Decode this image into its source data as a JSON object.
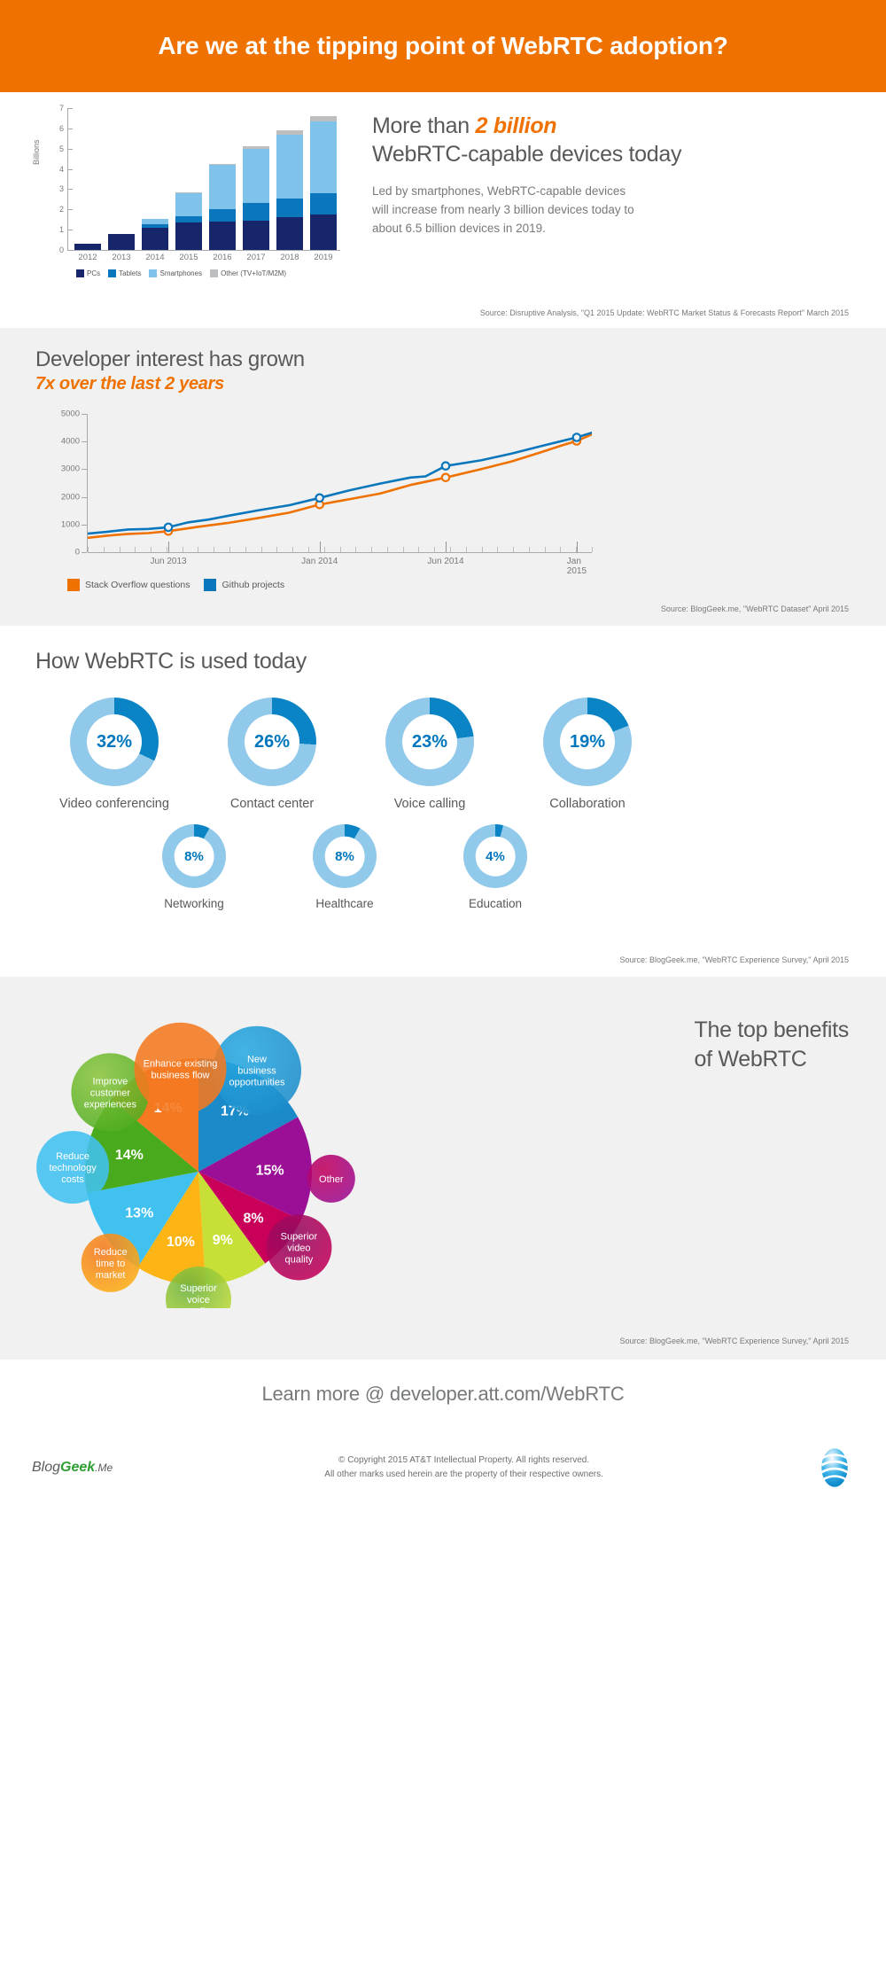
{
  "header": {
    "title": "Are we at the tipping point of WebRTC adoption?"
  },
  "section_devices": {
    "headline_pre": "More than ",
    "headline_hi": "2 billion",
    "headline_rest": "WebRTC-capable devices today",
    "body": "Led by smartphones, WebRTC-capable devices will increase from nearly 3 billion devices today to about 6.5 billion devices in 2019.",
    "source": "Source: Disruptive Analysis, \"Q1 2015 Update: WebRTC Market Status & Forecasts Report\" March 2015"
  },
  "section_developer": {
    "headline": "Developer interest has grown",
    "subhead": "7x over the last 2 years",
    "source": "Source: BlogGeek.me, \"WebRTC Dataset\" April 2015"
  },
  "section_usage": {
    "headline": "How WebRTC is used today",
    "source": "Source: BlogGeek.me, \"WebRTC Experience Survey,\" April 2015"
  },
  "section_benefits": {
    "headline_l1": "The top benefits",
    "headline_l2": "of WebRTC",
    "source": "Source: BlogGeek.me, \"WebRTC Experience Survey,\" April 2015"
  },
  "footer": {
    "learn_more": "Learn more @ developer.att.com/WebRTC",
    "blogeek": {
      "part1": "Blog",
      "part2": "Geek",
      "part3": ".Me"
    },
    "copyright_line1": "© Copyright 2015 AT&T Intellectual Property. All rights reserved.",
    "copyright_line2": "All other marks used herein are the property of their respective owners."
  },
  "colors": {
    "orange": "#ef7100",
    "navy": "#17256b",
    "mid_blue": "#0a76bc",
    "light_blue": "#7fc3ea",
    "grey": "#bcbec0",
    "accent_blue": "#0076bd",
    "track_blue": "#90c9e9"
  },
  "chart_data": [
    {
      "type": "bar",
      "title": "WebRTC-capable devices",
      "stacked": true,
      "ylabel": "Billions",
      "xlabel": "",
      "ylim": [
        0,
        7
      ],
      "yticks": [
        0,
        1,
        2,
        3,
        4,
        5,
        6,
        7
      ],
      "categories": [
        "2012",
        "2013",
        "2014",
        "2015",
        "2016",
        "2017",
        "2018",
        "2019"
      ],
      "series": [
        {
          "name": "PCs",
          "color": "#17256b",
          "values": [
            0.3,
            0.8,
            1.1,
            1.35,
            1.4,
            1.45,
            1.6,
            1.75
          ]
        },
        {
          "name": "Tablets",
          "color": "#0a76bc",
          "values": [
            0.0,
            0.0,
            0.15,
            0.3,
            0.6,
            0.85,
            0.95,
            1.05
          ]
        },
        {
          "name": "Smartphones",
          "color": "#7fc3ea",
          "values": [
            0.0,
            0.0,
            0.3,
            1.15,
            2.2,
            2.7,
            3.15,
            3.55
          ]
        },
        {
          "name": "Other (TV+IoT/M2M)",
          "color": "#bcbec0",
          "values": [
            0.0,
            0.0,
            0.0,
            0.05,
            0.05,
            0.1,
            0.2,
            0.25
          ]
        }
      ],
      "totals": [
        0.3,
        0.8,
        1.55,
        2.85,
        4.25,
        5.1,
        5.9,
        6.6
      ],
      "legend_position": "bottom"
    },
    {
      "type": "line",
      "title": "Developer interest has grown",
      "ylim": [
        0,
        5000
      ],
      "yticks": [
        0,
        1000,
        2000,
        3000,
        4000,
        5000
      ],
      "xlabel": "",
      "ylabel": "",
      "xticklabels": [
        "Jun 2013",
        "Jan 2014",
        "Jun 2014",
        "Jan 2015"
      ],
      "xtick_positions": [
        0.16,
        0.46,
        0.71,
        0.97
      ],
      "legend_position": "bottom",
      "series": [
        {
          "name": "Stack Overflow questions",
          "color": "#ef7100",
          "points": [
            [
              0.0,
              520
            ],
            [
              0.04,
              600
            ],
            [
              0.08,
              660
            ],
            [
              0.12,
              690
            ],
            [
              0.16,
              760
            ],
            [
              0.22,
              920
            ],
            [
              0.28,
              1060
            ],
            [
              0.34,
              1240
            ],
            [
              0.4,
              1430
            ],
            [
              0.46,
              1720
            ],
            [
              0.52,
              1920
            ],
            [
              0.58,
              2120
            ],
            [
              0.64,
              2430
            ],
            [
              0.71,
              2700
            ],
            [
              0.78,
              3000
            ],
            [
              0.84,
              3280
            ],
            [
              0.9,
              3620
            ],
            [
              0.94,
              3860
            ],
            [
              0.97,
              4020
            ],
            [
              1.0,
              4260
            ]
          ],
          "markers": [
            [
              0.16,
              760
            ],
            [
              0.46,
              1720
            ],
            [
              0.71,
              2700
            ],
            [
              0.97,
              4020
            ]
          ]
        },
        {
          "name": "Github projects",
          "color": "#0a76bc",
          "points": [
            [
              0.0,
              670
            ],
            [
              0.04,
              740
            ],
            [
              0.08,
              820
            ],
            [
              0.12,
              840
            ],
            [
              0.16,
              900
            ],
            [
              0.2,
              1080
            ],
            [
              0.24,
              1180
            ],
            [
              0.28,
              1320
            ],
            [
              0.34,
              1520
            ],
            [
              0.4,
              1700
            ],
            [
              0.46,
              1960
            ],
            [
              0.52,
              2240
            ],
            [
              0.58,
              2480
            ],
            [
              0.64,
              2700
            ],
            [
              0.67,
              2740
            ],
            [
              0.71,
              3120
            ],
            [
              0.78,
              3320
            ],
            [
              0.84,
              3560
            ],
            [
              0.9,
              3840
            ],
            [
              0.97,
              4150
            ],
            [
              1.0,
              4320
            ]
          ],
          "markers": [
            [
              0.16,
              900
            ],
            [
              0.46,
              1960
            ],
            [
              0.71,
              3120
            ],
            [
              0.97,
              4150
            ]
          ]
        }
      ]
    },
    {
      "type": "pie",
      "title": "How WebRTC is used today",
      "representation": "donut-set",
      "items": [
        {
          "label": "Video conferencing",
          "value": 32,
          "display": "32%"
        },
        {
          "label": "Contact center",
          "value": 26,
          "display": "26%"
        },
        {
          "label": "Voice calling",
          "value": 23,
          "display": "23%"
        },
        {
          "label": "Collaboration",
          "value": 19,
          "display": "19%"
        },
        {
          "label": "Networking",
          "value": 8,
          "display": "8%"
        },
        {
          "label": "Healthcare",
          "value": 8,
          "display": "8%"
        },
        {
          "label": "Education",
          "value": 4,
          "display": "4%"
        }
      ]
    },
    {
      "type": "pie",
      "title": "The top benefits of WebRTC",
      "representation": "flower-pie",
      "slices": [
        {
          "label": "New business opportunities",
          "value": 17,
          "display": "17%",
          "color": "#1b8ac9",
          "bubble": "#29abe2"
        },
        {
          "label": "Superior video quality",
          "value": 15,
          "display": "15%",
          "color": "#9a0f96",
          "bubble": "#c2005b"
        },
        {
          "label": "Other",
          "value": 8,
          "display": "8%",
          "color": "#c8005a",
          "bubble": "#8e0d60"
        },
        {
          "label": "Superior voice quality",
          "value": 9,
          "display": "9%",
          "color": "#c8df38",
          "bubble": "#6cb33f"
        },
        {
          "label": "Reduce time to market",
          "value": 10,
          "display": "10%",
          "color": "#fdb515",
          "bubble": "#f47920"
        },
        {
          "label": "Reduce technology costs",
          "value": 13,
          "display": "13%",
          "color": "#41c1f0",
          "bubble": "#41c1f0"
        },
        {
          "label": "Improve customer experiences",
          "value": 14,
          "display": "14%",
          "color": "#4aaa1e",
          "bubble": "#8cc63f"
        },
        {
          "label": "Enhance existing business flow",
          "value": 14,
          "display": "14%",
          "color": "#f47920",
          "bubble": "#f47920"
        }
      ]
    }
  ]
}
